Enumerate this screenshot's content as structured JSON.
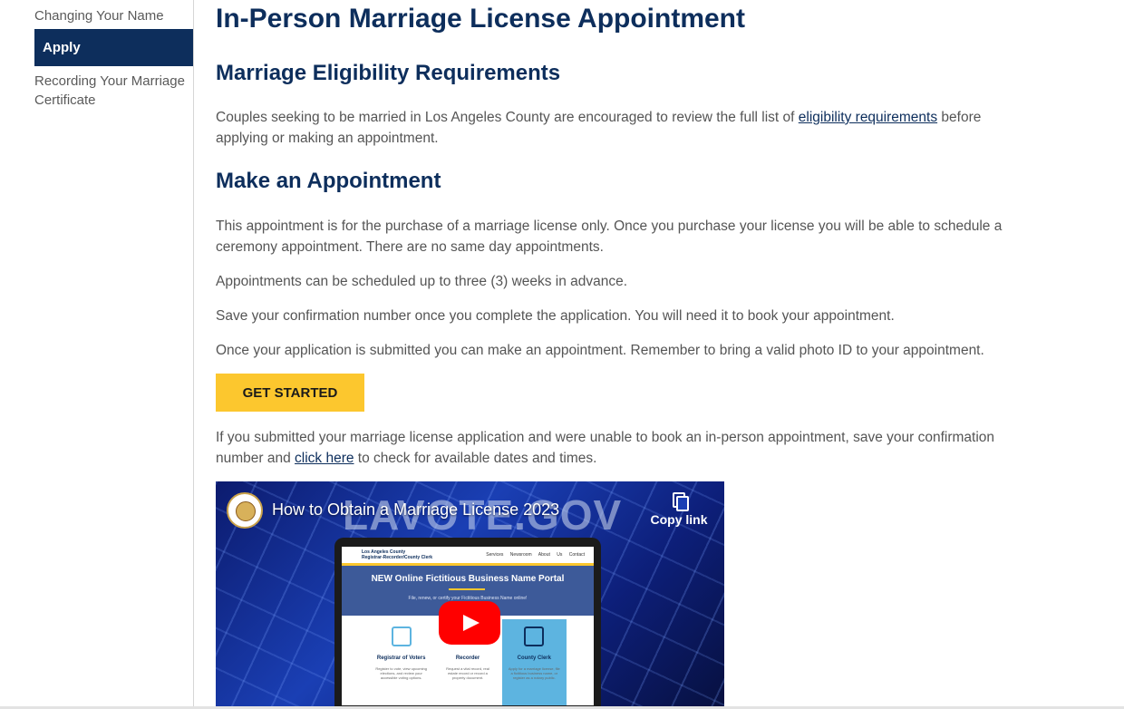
{
  "sidebar": {
    "items": [
      {
        "label": "Changing Your Name"
      },
      {
        "label": "Apply"
      },
      {
        "label": "Recording Your Marriage Certificate"
      }
    ]
  },
  "main": {
    "title": "In-Person Marriage License Appointment",
    "eligibility": {
      "heading": "Marriage Eligibility Requirements",
      "text_before": "Couples seeking to be married in Los Angeles County are encouraged to review the full list of ",
      "link": "eligibility requirements",
      "text_after": " before applying or making an appointment."
    },
    "appointment": {
      "heading": "Make an Appointment",
      "p1": "This appointment is for the purchase of a marriage license only. Once you purchase your license you will be able to schedule a ceremony appointment. There are no same day appointments.",
      "p2": "Appointments can be scheduled up to three (3) weeks in advance.",
      "p3": "Save your confirmation number once you complete the application. You will need it to book your appointment.",
      "p4": "Once your application is submitted you can make an appointment. Remember to bring a valid photo ID to your appointment.",
      "button": "GET STARTED",
      "p5_before": "If you submitted your marriage license application and were unable to book an in-person appointment, save your confirmation number and ",
      "p5_link": "click here",
      "p5_after": " to check for available dates and times."
    },
    "video": {
      "title": "How to Obtain a Marriage License 2023",
      "bg_text": "LAVOTE.GOV",
      "copy_label": "Copy link",
      "screen": {
        "brand_line1": "Los Angeles County",
        "brand_line2": "Registrar-Recorder/County Clerk",
        "nav": "Services Newsroom About Us Contact",
        "hero_title": "NEW Online Fictitious Business Name Portal",
        "hero_sub": "File, renew, or certify your Fictitious Business Name online!",
        "cards": [
          {
            "title": "Registrar of Voters",
            "text": "Register to vote, view upcoming elections, and review your accessible voting options."
          },
          {
            "title": "Recorder",
            "text": "Request a vital record, real estate record or record a property document."
          },
          {
            "title": "County Clerk",
            "text": "Apply for a marriage license, file a fictitious business name, or register as a notary public."
          }
        ]
      }
    }
  },
  "colors": {
    "navy": "#0d2e5c",
    "button_yellow": "#fcc72e",
    "body_text": "#555555"
  }
}
